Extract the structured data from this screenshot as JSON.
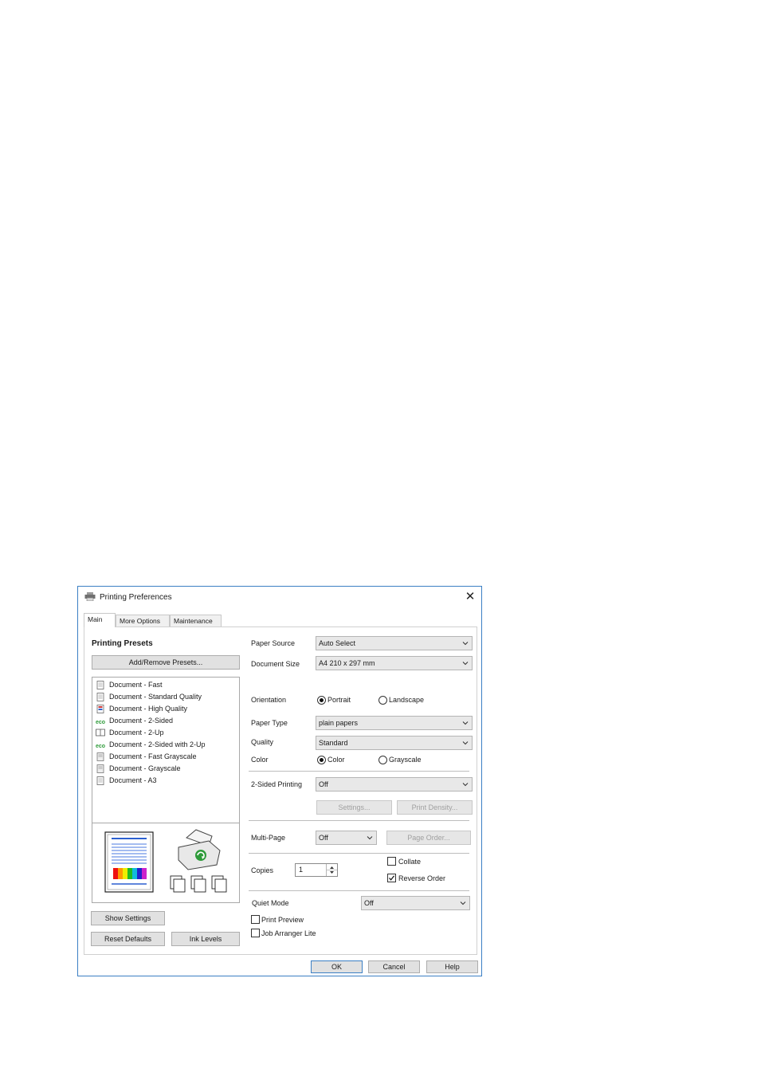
{
  "window": {
    "title": "Printing Preferences"
  },
  "tabs": [
    {
      "label": "Main"
    },
    {
      "label": "More Options"
    },
    {
      "label": "Maintenance"
    }
  ],
  "presets": {
    "heading": "Printing Presets",
    "add_remove_button": "Add/Remove Presets...",
    "items": [
      {
        "label": "Document - Fast",
        "icon": "document-icon"
      },
      {
        "label": "Document - Standard Quality",
        "icon": "document-icon"
      },
      {
        "label": "Document - High Quality",
        "icon": "document-color-icon"
      },
      {
        "label": "Document - 2-Sided",
        "icon": "eco-icon"
      },
      {
        "label": "Document - 2-Up",
        "icon": "two-up-icon"
      },
      {
        "label": "Document - 2-Sided with 2-Up",
        "icon": "eco-icon"
      },
      {
        "label": "Document - Fast Grayscale",
        "icon": "document-gray-icon"
      },
      {
        "label": "Document - Grayscale",
        "icon": "document-gray-icon"
      },
      {
        "label": "Document - A3",
        "icon": "document-icon"
      }
    ]
  },
  "left_buttons": {
    "show_settings": "Show Settings",
    "reset_defaults": "Reset Defaults",
    "ink_levels": "Ink Levels"
  },
  "settings": {
    "paper_source": {
      "label": "Paper Source",
      "value": "Auto Select"
    },
    "document_size": {
      "label": "Document Size",
      "value": "A4 210 x 297 mm"
    },
    "orientation": {
      "label": "Orientation",
      "options": [
        "Portrait",
        "Landscape"
      ],
      "selected": "Portrait"
    },
    "paper_type": {
      "label": "Paper Type",
      "value": "plain papers"
    },
    "quality": {
      "label": "Quality",
      "value": "Standard"
    },
    "color": {
      "label": "Color",
      "options": [
        "Color",
        "Grayscale"
      ],
      "selected": "Color"
    },
    "two_sided": {
      "label": "2-Sided Printing",
      "value": "Off",
      "settings_button": "Settings...",
      "print_density_button": "Print Density..."
    },
    "multi_page": {
      "label": "Multi-Page",
      "value": "Off",
      "page_order_button": "Page Order..."
    },
    "copies": {
      "label": "Copies",
      "value": "1",
      "collate_label": "Collate",
      "collate_checked": false,
      "reverse_order_label": "Reverse Order",
      "reverse_order_checked": true
    },
    "quiet_mode": {
      "label": "Quiet Mode",
      "value": "Off"
    },
    "print_preview": {
      "label": "Print Preview",
      "checked": false
    },
    "job_arranger": {
      "label": "Job Arranger Lite",
      "checked": false
    }
  },
  "footer": {
    "ok": "OK",
    "cancel": "Cancel",
    "help": "Help"
  },
  "colors": {
    "accent": "#3b7fc4",
    "eco_green": "#2e9b3a"
  }
}
